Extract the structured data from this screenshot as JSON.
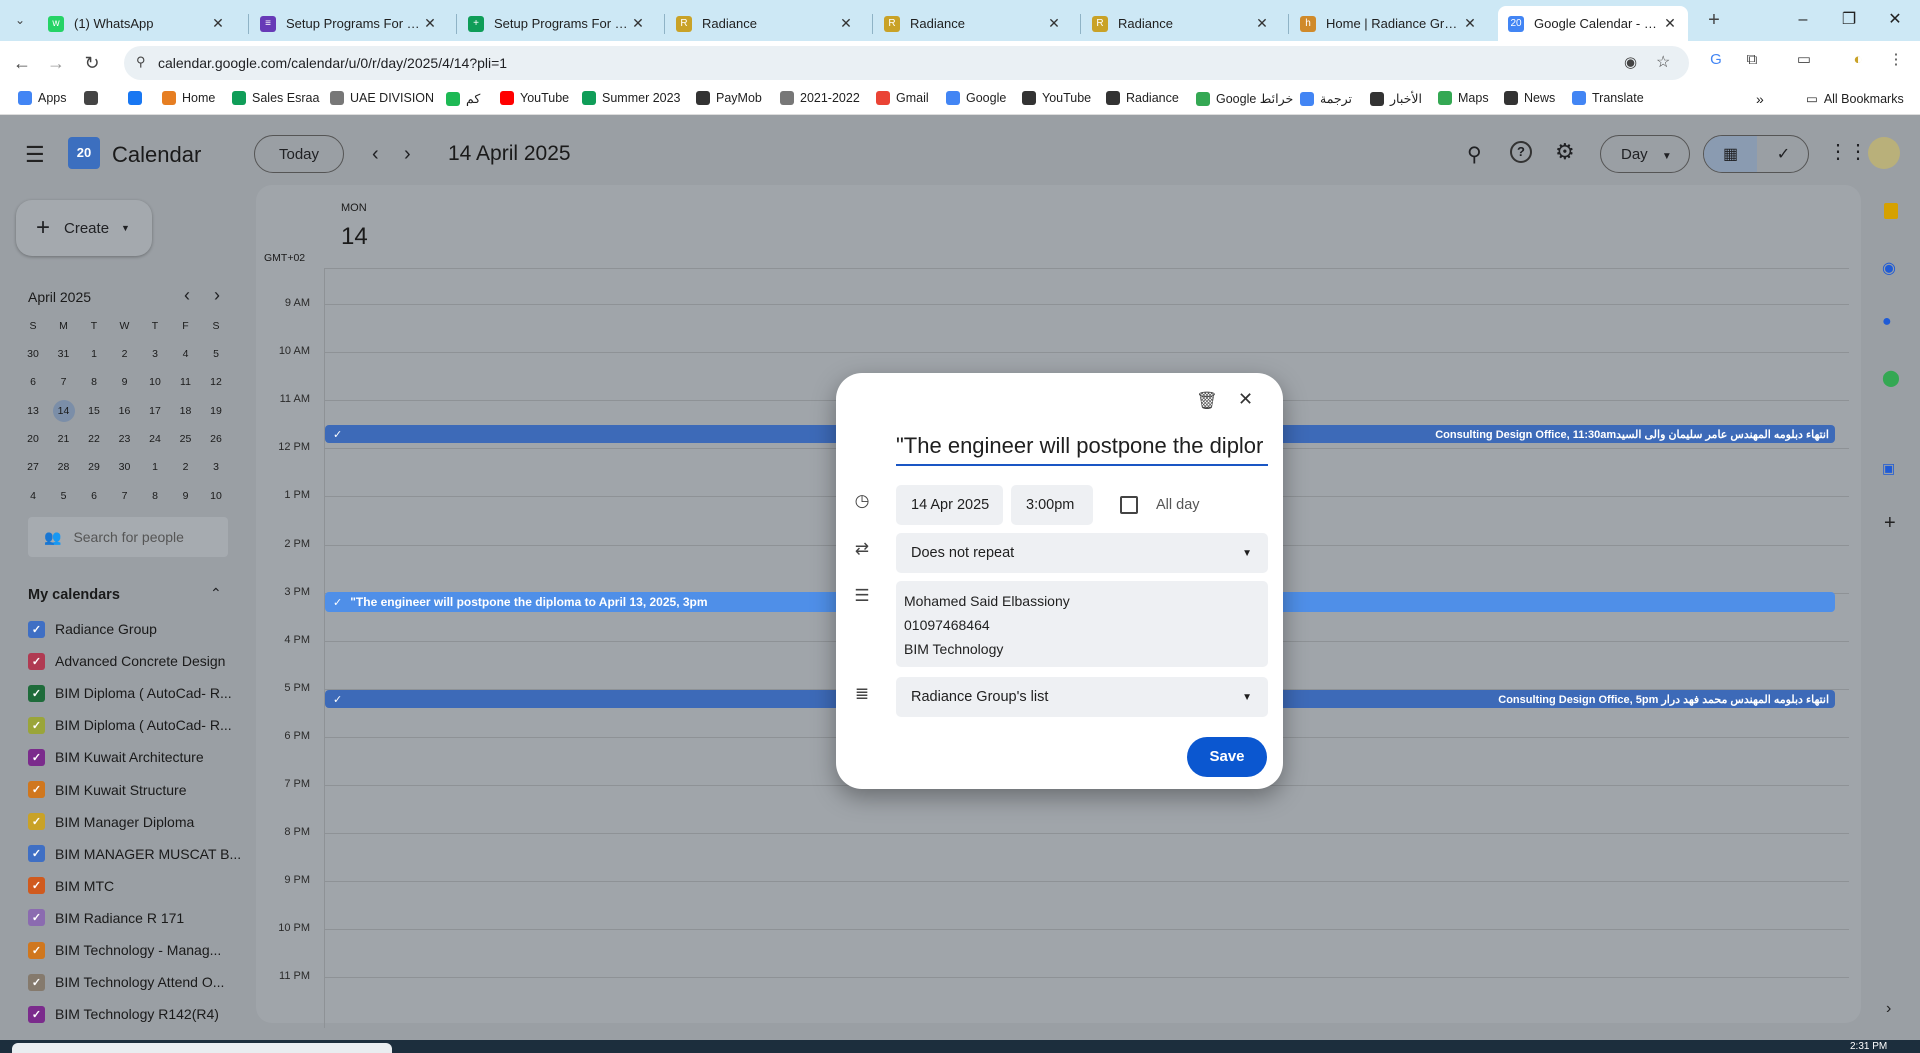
{
  "browser": {
    "tabs": [
      {
        "title": "(1) WhatsApp",
        "color": "#25d366",
        "glyph": "w"
      },
      {
        "title": "Setup Programs For Diplo",
        "color": "#673ab7",
        "glyph": "≡"
      },
      {
        "title": "Setup Programs For Diplo",
        "color": "#0f9d58",
        "glyph": "+"
      },
      {
        "title": "Radiance",
        "color": "#c9a227",
        "glyph": "R"
      },
      {
        "title": "Radiance",
        "color": "#c9a227",
        "glyph": "R"
      },
      {
        "title": "Radiance",
        "color": "#c9a227",
        "glyph": "R"
      },
      {
        "title": "Home | Radiance Group",
        "color": "#d08a2a",
        "glyph": "h"
      },
      {
        "title": "Google Calendar - Monda",
        "color": "#4285f4",
        "glyph": "20"
      }
    ],
    "url": "calendar.google.com/calendar/u/0/r/day/2025/4/14?pli=1",
    "bookmarks": [
      {
        "label": "Apps",
        "color": "#4285f4"
      },
      {
        "label": "",
        "color": "#444444"
      },
      {
        "label": "",
        "color": "#1877f2"
      },
      {
        "label": "Home",
        "color": "#e67e22"
      },
      {
        "label": "Sales Esraa",
        "color": "#0f9d58"
      },
      {
        "label": "UAE DIVISION",
        "color": "#777777"
      },
      {
        "label": "كم",
        "color": "#1db954"
      },
      {
        "label": "YouTube",
        "color": "#ff0000"
      },
      {
        "label": "Summer 2023",
        "color": "#0f9d58"
      },
      {
        "label": "PayMob",
        "color": "#333333"
      },
      {
        "label": "2021-2022",
        "color": "#777777"
      },
      {
        "label": "Gmail",
        "color": "#ea4335"
      },
      {
        "label": "Google",
        "color": "#4285f4"
      },
      {
        "label": "YouTube",
        "color": "#333333"
      },
      {
        "label": "Radiance",
        "color": "#333333"
      },
      {
        "label": "Google خرائط",
        "color": "#34a853"
      },
      {
        "label": "ترجمة",
        "color": "#4285f4"
      },
      {
        "label": "الأخبار",
        "color": "#333333"
      },
      {
        "label": "Maps",
        "color": "#34a853"
      },
      {
        "label": "News",
        "color": "#333333"
      },
      {
        "label": "Translate",
        "color": "#4285f4"
      }
    ],
    "all_bookmarks": "All Bookmarks"
  },
  "calendar": {
    "app_name": "Calendar",
    "logo_day": "20",
    "today_button": "Today",
    "current_date": "14 April 2025",
    "view_selector": "Day",
    "create_button": "Create",
    "day_label": "MON",
    "day_number": "14",
    "timezone": "GMT+02",
    "hours": [
      "9 AM",
      "10 AM",
      "11 AM",
      "12 PM",
      "1 PM",
      "2 PM",
      "3 PM",
      "4 PM",
      "5 PM",
      "6 PM",
      "7 PM",
      "8 PM",
      "9 PM",
      "10 PM",
      "11 PM"
    ],
    "events": [
      {
        "left_text": "",
        "right_text": "انتهاء دبلومه المهندس عامر سليمان والى السيدConsulting Design Office, 11:30am"
      },
      {
        "left_text": "\"The engineer will postpone the diploma to April 13, 2025, 3pm",
        "right_text": ""
      },
      {
        "left_text": "",
        "right_text": "انتهاء دبلومه المهندس محمد فهد درار Consulting Design Office, 5pm"
      }
    ],
    "mini_month": {
      "title": "April 2025",
      "weekdays": [
        "S",
        "M",
        "T",
        "W",
        "T",
        "F",
        "S"
      ],
      "weeks": [
        [
          "30",
          "31",
          "1",
          "2",
          "3",
          "4",
          "5"
        ],
        [
          "6",
          "7",
          "8",
          "9",
          "10",
          "11",
          "12"
        ],
        [
          "13",
          "14",
          "15",
          "16",
          "17",
          "18",
          "19"
        ],
        [
          "20",
          "21",
          "22",
          "23",
          "24",
          "25",
          "26"
        ],
        [
          "27",
          "28",
          "29",
          "30",
          "1",
          "2",
          "3"
        ],
        [
          "4",
          "5",
          "6",
          "7",
          "8",
          "9",
          "10"
        ]
      ],
      "selected": "14"
    },
    "search_people_placeholder": "Search for people",
    "my_calendars_title": "My calendars",
    "my_calendars": [
      {
        "label": "Radiance Group",
        "color": "#3f6fc4"
      },
      {
        "label": "Advanced Concrete Design",
        "color": "#b03a52"
      },
      {
        "label": "BIM Diploma ( AutoCad- R...",
        "color": "#1e6b3a"
      },
      {
        "label": "BIM Diploma ( AutoCad- R...",
        "color": "#9aa53a"
      },
      {
        "label": "BIM Kuwait Architecture",
        "color": "#7b2b8c"
      },
      {
        "label": "BIM Kuwait Structure",
        "color": "#d0771e"
      },
      {
        "label": "BIM Manager Diploma",
        "color": "#c9a227"
      },
      {
        "label": "BIM MANAGER MUSCAT B...",
        "color": "#3f6fc4"
      },
      {
        "label": "BIM MTC",
        "color": "#d05a1e"
      },
      {
        "label": "BIM Radiance R 171",
        "color": "#8b6bb0"
      },
      {
        "label": "BIM Technology - Manag...",
        "color": "#d0771e"
      },
      {
        "label": "BIM Technology Attend O...",
        "color": "#857a6d"
      },
      {
        "label": "BIM Technology R142(R4)",
        "color": "#7b2b8c"
      }
    ]
  },
  "dialog": {
    "title_value": "\"The engineer will postpone the diplor",
    "date": "14 Apr 2025",
    "time": "3:00pm",
    "all_day_label": "All day",
    "repeat": "Does not repeat",
    "description_lines": [
      "Mohamed Said Elbassiony",
      "01097468464",
      "BIM Technology"
    ],
    "list": "Radiance Group's list",
    "save_button": "Save"
  },
  "taskbar": {
    "clock": "2:31 PM"
  }
}
